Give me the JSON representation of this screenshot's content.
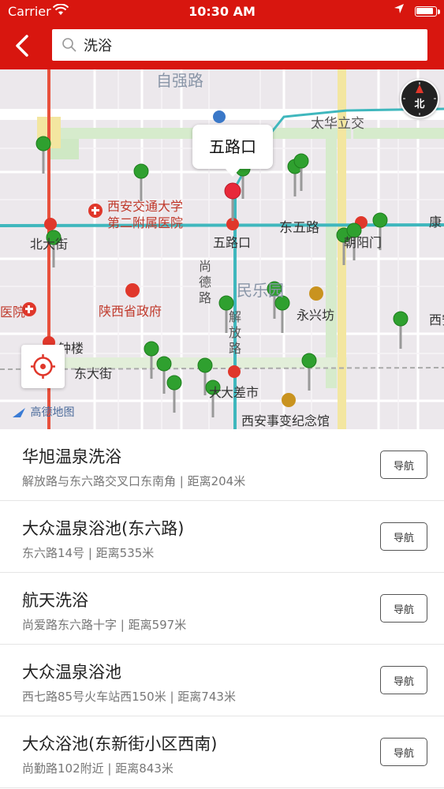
{
  "status_bar": {
    "carrier": "Carrier",
    "time": "10:30 AM"
  },
  "search": {
    "query": "洗浴"
  },
  "map": {
    "callout": "五路口",
    "compass_label": "北",
    "logo": "高德地图",
    "labels": [
      {
        "text": "自强路",
        "style": "big"
      },
      {
        "text": "太华立交"
      },
      {
        "text": "西安交通大学"
      },
      {
        "text": "第二附属医院"
      },
      {
        "text": "五路口"
      },
      {
        "text": "东五路"
      },
      {
        "text": "北大街"
      },
      {
        "text": "朝阳门"
      },
      {
        "text": "尚"
      },
      {
        "text": "德"
      },
      {
        "text": "路"
      },
      {
        "text": "民乐园",
        "style": "big"
      },
      {
        "text": "陕西省政府"
      },
      {
        "text": "永兴坊"
      },
      {
        "text": "解"
      },
      {
        "text": "放"
      },
      {
        "text": "路"
      },
      {
        "text": "钟楼"
      },
      {
        "text": "东大街"
      },
      {
        "text": "大差市"
      },
      {
        "text": "西安事变纪念馆"
      },
      {
        "text": "康"
      },
      {
        "text": "医院"
      },
      {
        "text": "西安"
      },
      {
        "text": "大"
      }
    ]
  },
  "results": [
    {
      "name": "华旭温泉洗浴",
      "detail": "解放路与东六路交叉口东南角 | 距离204米",
      "nav_label": "导航"
    },
    {
      "name": "大众温泉浴池(东六路)",
      "detail": "东六路14号 | 距离535米",
      "nav_label": "导航"
    },
    {
      "name": "航天洗浴",
      "detail": "尚爱路东六路十字 | 距离597米",
      "nav_label": "导航"
    },
    {
      "name": "大众温泉浴池",
      "detail": "西七路85号火车站西150米 | 距离743米",
      "nav_label": "导航"
    },
    {
      "name": "大众浴池(东新街小区西南)",
      "detail": "尚勤路102附近 | 距离843米",
      "nav_label": "导航"
    }
  ]
}
